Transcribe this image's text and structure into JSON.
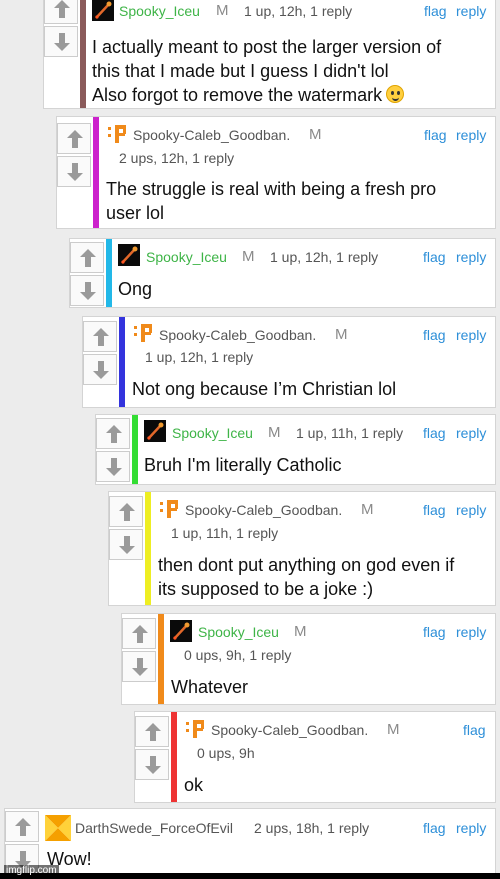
{
  "comments": [
    {
      "username": "Spooky_Iceu",
      "mod": "M",
      "meta": "1 up, 12h, 1 reply",
      "flag": "flag",
      "reply": "reply",
      "body": "I actually meant to post the larger version of\nthis that I made but I guess I didn't lol\nAlso forgot to remove the watermark",
      "bar_color": "#8a5a5a",
      "avatar": "rocket-avatar"
    },
    {
      "username": "Spooky-Caleb_Goodban.",
      "mod": "M",
      "meta": "2 ups, 12h, 1 reply",
      "flag": "flag",
      "reply": "reply",
      "body": "The struggle is real with being a fresh pro\nuser lol",
      "bar_color": "#cc22cc",
      "avatar": "pixel-p-avatar"
    },
    {
      "username": "Spooky_Iceu",
      "mod": "M",
      "meta": "1 up, 12h, 1 reply",
      "flag": "flag",
      "reply": "reply",
      "body": "Ong",
      "bar_color": "#22b8e8",
      "avatar": "rocket-avatar"
    },
    {
      "username": "Spooky-Caleb_Goodban.",
      "mod": "M",
      "meta": "1 up, 12h, 1 reply",
      "flag": "flag",
      "reply": "reply",
      "body": "Not ong because I’m Christian lol",
      "bar_color": "#3333dd",
      "avatar": "pixel-p-avatar"
    },
    {
      "username": "Spooky_Iceu",
      "mod": "M",
      "meta": "1 up, 11h, 1 reply",
      "flag": "flag",
      "reply": "reply",
      "body": "Bruh I'm literally Catholic",
      "bar_color": "#33dd33",
      "avatar": "rocket-avatar"
    },
    {
      "username": "Spooky-Caleb_Goodban.",
      "mod": "M",
      "meta": "1 up, 11h, 1 reply",
      "flag": "flag",
      "reply": "reply",
      "body": "then dont put anything on god even if\nits supposed to be a joke :)",
      "bar_color": "#eeee22",
      "avatar": "pixel-p-avatar"
    },
    {
      "username": "Spooky_Iceu",
      "mod": "M",
      "meta": "0 ups, 9h, 1 reply",
      "flag": "flag",
      "reply": "reply",
      "body": "Whatever",
      "bar_color": "#f08a1a",
      "avatar": "rocket-avatar"
    },
    {
      "username": "Spooky-Caleb_Goodban.",
      "mod": "M",
      "meta": "0 ups, 9h",
      "flag": "flag",
      "reply": "",
      "body": "ok",
      "bar_color": "#ee3333",
      "avatar": "pixel-p-avatar"
    },
    {
      "username": "DarthSwede_ForceOfEvil",
      "mod": "",
      "meta": "2 ups, 18h, 1 reply",
      "flag": "flag",
      "reply": "reply",
      "body": "Wow!",
      "bar_color": "",
      "avatar": "pinwheel-avatar"
    }
  ],
  "watermark": "imgflip.com"
}
